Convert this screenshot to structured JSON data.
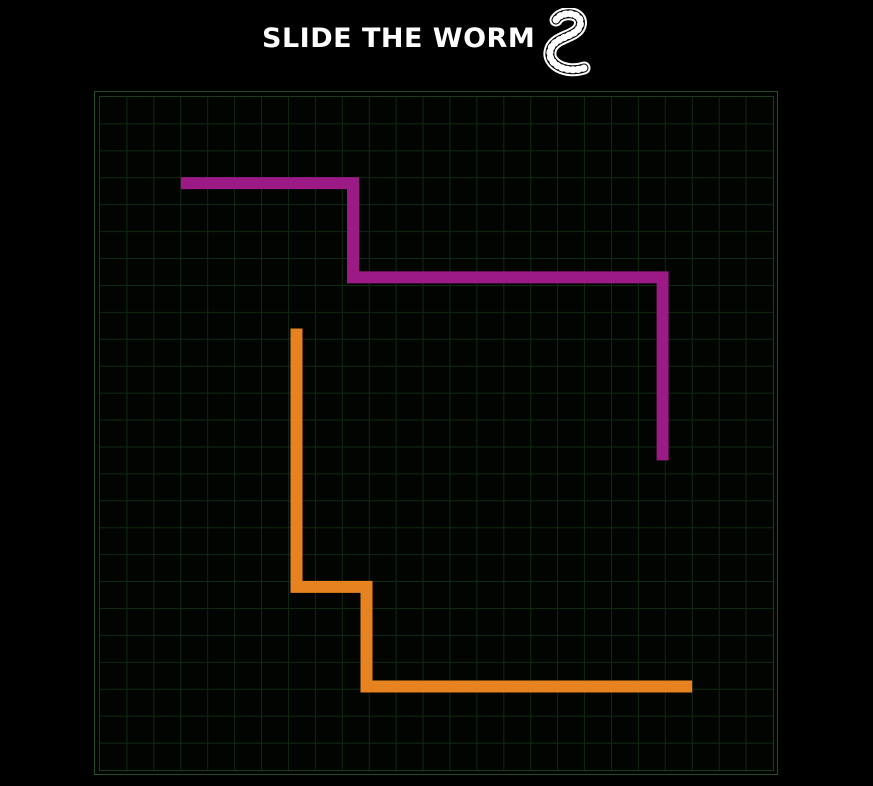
{
  "header": {
    "title": "Slide the Worm",
    "logo_icon": "worm-icon"
  },
  "game": {
    "board_cols": 25,
    "board_rows": 25,
    "colors": {
      "background": "#000000",
      "board": "#020402",
      "grid_line": "#0f2a12",
      "border": "#2a4a2a"
    },
    "worms": [
      {
        "id": "purple-worm",
        "color": "#9b1a85",
        "path": [
          [
            3.0,
            3.2
          ],
          [
            9.4,
            3.2
          ],
          [
            9.4,
            6.7
          ],
          [
            20.9,
            6.7
          ],
          [
            20.9,
            13.5
          ]
        ]
      },
      {
        "id": "orange-worm",
        "color": "#e6821f",
        "path": [
          [
            7.3,
            8.6
          ],
          [
            7.3,
            18.2
          ],
          [
            9.9,
            18.2
          ],
          [
            9.9,
            21.9
          ],
          [
            22.0,
            21.9
          ]
        ]
      }
    ]
  }
}
